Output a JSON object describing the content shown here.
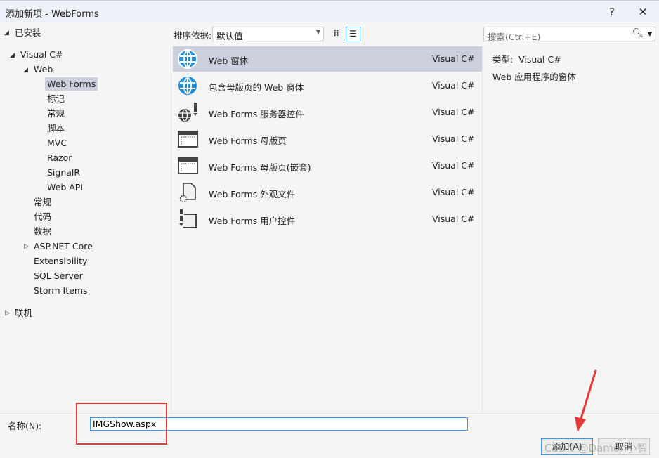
{
  "window": {
    "title": "添加新项 - WebForms",
    "help": "?",
    "close": "✕"
  },
  "tree": {
    "installed": "已安装",
    "visual_csharp": "Visual C#",
    "web": "Web",
    "web_children": [
      "Web Forms",
      "标记",
      "常规",
      "脚本",
      "MVC",
      "Razor",
      "SignalR",
      "Web API"
    ],
    "csharp_children": [
      "常规",
      "代码",
      "数据",
      "ASP.NET Core",
      "Extensibility",
      "SQL Server",
      "Storm Items"
    ],
    "online": "联机"
  },
  "sort": {
    "label": "排序依据:",
    "value": "默认值"
  },
  "search": {
    "placeholder": "搜索(Ctrl+E)"
  },
  "templates": [
    {
      "name": "Web 窗体",
      "lang": "Visual C#",
      "icon": "globe-icon"
    },
    {
      "name": "包含母版页的 Web 窗体",
      "lang": "Visual C#",
      "icon": "globe-icon"
    },
    {
      "name": "Web Forms 服务器控件",
      "lang": "Visual C#",
      "icon": "server-control-icon"
    },
    {
      "name": "Web Forms 母版页",
      "lang": "Visual C#",
      "icon": "master-page-icon"
    },
    {
      "name": "Web Forms 母版页(嵌套)",
      "lang": "Visual C#",
      "icon": "master-page-icon"
    },
    {
      "name": "Web Forms 外观文件",
      "lang": "Visual C#",
      "icon": "skin-file-icon"
    },
    {
      "name": "Web Forms 用户控件",
      "lang": "Visual C#",
      "icon": "user-control-icon"
    }
  ],
  "info": {
    "type_label": "类型:",
    "type_value": "Visual C#",
    "description": "Web 应用程序的窗体"
  },
  "form": {
    "name_label": "名称(N):",
    "name_value": "IMGShow.aspx"
  },
  "buttons": {
    "add": "添加(A)",
    "cancel": "取消"
  },
  "watermark": "CSDN @Damon小智",
  "colors": {
    "accent": "#3399ff",
    "selection": "#ccd0dc",
    "annotation": "#e53935"
  }
}
